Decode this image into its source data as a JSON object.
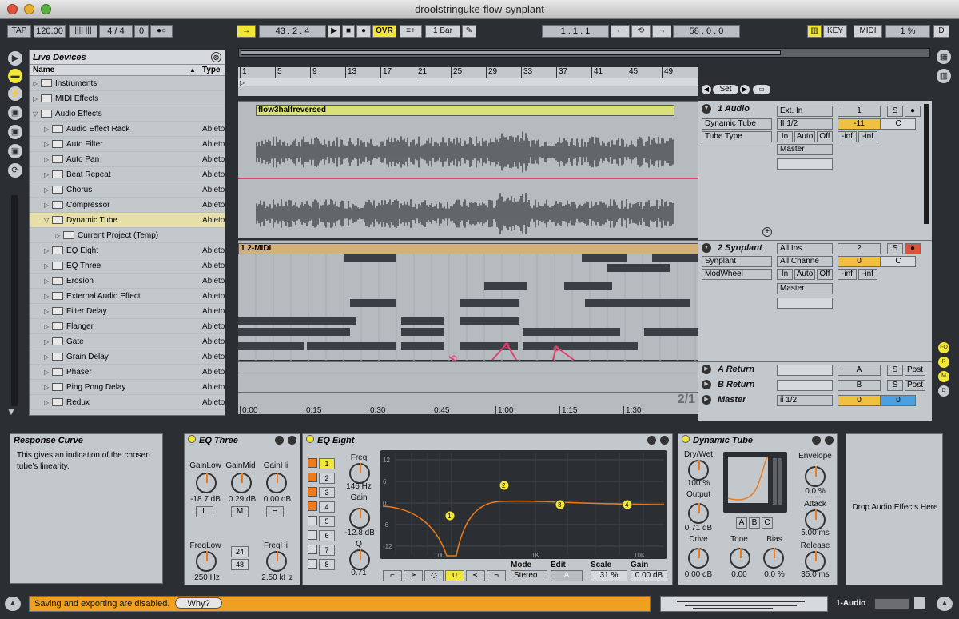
{
  "window": {
    "title": "droolstringuke-flow-synplant"
  },
  "toolbar": {
    "tap": "TAP",
    "tempo": "120.00",
    "sig": "4 / 4",
    "quant_off": "0",
    "position": "43 .  2 .  4",
    "ovr": "OVR",
    "quant": "1 Bar",
    "loop_start": "1 .  1 .  1",
    "loop_len": "58 .  0 .  0",
    "key": "KEY",
    "midi": "MIDI",
    "cpu": "1 %",
    "d": "D"
  },
  "browser": {
    "title": "Live Devices",
    "col_name": "Name",
    "col_type": "Type",
    "items": [
      {
        "label": "Instruments",
        "type": "",
        "level": 0
      },
      {
        "label": "MIDI Effects",
        "type": "",
        "level": 0
      },
      {
        "label": "Audio Effects",
        "type": "",
        "level": 0
      },
      {
        "label": "Audio Effect Rack",
        "type": "Ableto",
        "level": 1
      },
      {
        "label": "Auto Filter",
        "type": "Ableto",
        "level": 1
      },
      {
        "label": "Auto Pan",
        "type": "Ableto",
        "level": 1
      },
      {
        "label": "Beat Repeat",
        "type": "Ableto",
        "level": 1
      },
      {
        "label": "Chorus",
        "type": "Ableto",
        "level": 1
      },
      {
        "label": "Compressor",
        "type": "Ableto",
        "level": 1
      },
      {
        "label": "Dynamic Tube",
        "type": "Ableto",
        "level": 1
      },
      {
        "label": "Current Project (Temp)",
        "type": "",
        "level": 2
      },
      {
        "label": "EQ Eight",
        "type": "Ableto",
        "level": 1
      },
      {
        "label": "EQ Three",
        "type": "Ableto",
        "level": 1
      },
      {
        "label": "Erosion",
        "type": "Ableto",
        "level": 1
      },
      {
        "label": "External Audio Effect",
        "type": "Ableto",
        "level": 1
      },
      {
        "label": "Filter Delay",
        "type": "Ableto",
        "level": 1
      },
      {
        "label": "Flanger",
        "type": "Ableto",
        "level": 1
      },
      {
        "label": "Gate",
        "type": "Ableto",
        "level": 1
      },
      {
        "label": "Grain Delay",
        "type": "Ableto",
        "level": 1
      },
      {
        "label": "Phaser",
        "type": "Ableto",
        "level": 1
      },
      {
        "label": "Ping Pong Delay",
        "type": "Ableto",
        "level": 1
      },
      {
        "label": "Redux",
        "type": "Ableto",
        "level": 1
      }
    ]
  },
  "ruler": {
    "bars": [
      "1",
      "5",
      "9",
      "13",
      "17",
      "21",
      "25",
      "29",
      "33",
      "37",
      "41",
      "45",
      "49"
    ],
    "times": [
      "0:00",
      "0:15",
      "0:30",
      "0:45",
      "1:00",
      "1:15",
      "1:30"
    ],
    "set": "Set",
    "sig": "2/1"
  },
  "clips": {
    "audio": "flow3halfreversed",
    "midi": "1 2-MIDI"
  },
  "tracks": {
    "t1": {
      "name": "1 Audio",
      "dev": "Dynamic Tube",
      "param": "Tube Type",
      "in": "Ext. In",
      "ch": "II 1/2",
      "mon_in": "In",
      "mon_auto": "Auto",
      "mon_off": "Off",
      "out": "Master",
      "num": "1",
      "vol": "-11",
      "pan": "C",
      "s": "S",
      "inf1": "-inf",
      "inf2": "-inf"
    },
    "t2": {
      "name": "2 Synplant",
      "dev": "Synplant",
      "param": "ModWheel",
      "in": "All Ins",
      "ch": "All Channe",
      "mon_in": "In",
      "mon_auto": "Auto",
      "mon_off": "Off",
      "out": "Master",
      "num": "2",
      "vol": "0",
      "pan": "C",
      "s": "S",
      "inf1": "-inf",
      "inf2": "-inf"
    },
    "ra": {
      "name": "A Return",
      "num": "A",
      "s": "S",
      "post": "Post"
    },
    "rb": {
      "name": "B Return",
      "num": "B",
      "s": "S",
      "post": "Post"
    },
    "master": {
      "name": "Master",
      "ch": "ii 1/2",
      "num": "0",
      "vol": "0"
    }
  },
  "info": {
    "title": "Response Curve",
    "text": "This gives an indication of the chosen tube's linearity."
  },
  "eq3": {
    "title": "EQ Three",
    "gl": "GainLow",
    "gm": "GainMid",
    "gh": "GainHi",
    "glv": "-18.7 dB",
    "gmv": "0.29 dB",
    "ghv": "0.00 dB",
    "l": "L",
    "m": "M",
    "h": "H",
    "fl": "FreqLow",
    "fh": "FreqHi",
    "flv": "250 Hz",
    "fhv": "2.50 kHz",
    "n24": "24",
    "n48": "48"
  },
  "eq8": {
    "title": "EQ Eight",
    "bands": [
      "1",
      "2",
      "3",
      "4",
      "5",
      "6",
      "7",
      "8"
    ],
    "freq": "Freq",
    "freqv": "146 Hz",
    "gain": "Gain",
    "gainv": "-12.8 dB",
    "q": "Q",
    "qv": "0.71",
    "mode": "Mode",
    "modev": "Stereo",
    "edit": "Edit",
    "editv": "A",
    "scale": "Scale",
    "scalev": "31 %",
    "gainl": "Gain",
    "gainlv": "0.00 dB",
    "ylabels": [
      "12",
      "6",
      "0",
      "-6",
      "-12"
    ],
    "xlabels": [
      "100",
      "1K",
      "10K"
    ]
  },
  "tube": {
    "title": "Dynamic Tube",
    "drywet": "Dry/Wet",
    "drywetv": "100 %",
    "output": "Output",
    "outputv": "0.71 dB",
    "drive": "Drive",
    "drivev": "0.00 dB",
    "tone": "Tone",
    "tonev": "0.00",
    "bias": "Bias",
    "biasv": "0.0 %",
    "env": "Envelope",
    "envv": "0.0 %",
    "attack": "Attack",
    "attackv": "5.00 ms",
    "release": "Release",
    "releasev": "35.0 ms",
    "a": "A",
    "b": "B",
    "c": "C"
  },
  "drop": {
    "text": "Drop Audio Effects Here"
  },
  "status": {
    "text": "Saving and exporting are disabled.",
    "why": "Why?",
    "track": "1-Audio"
  },
  "colors": {
    "accent": "#f2e63a",
    "orange": "#f07a1a",
    "clip": "#d9e27a"
  }
}
